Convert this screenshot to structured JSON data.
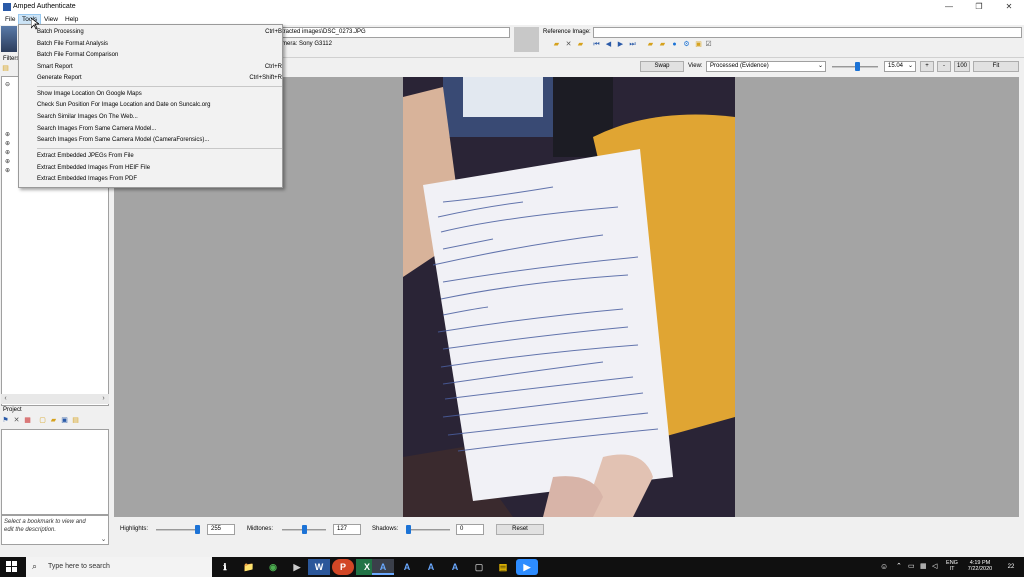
{
  "window": {
    "title": "Amped Authenticate",
    "minimize": "—",
    "restore": "❐",
    "close": "✕"
  },
  "menubar": {
    "items": [
      "File",
      "Tools",
      "View",
      "Help"
    ]
  },
  "tools_menu": {
    "group1": [
      {
        "label": "Batch Processing",
        "shortcut": "Ctrl+B"
      },
      {
        "label": "Batch File Format Analysis",
        "shortcut": ""
      },
      {
        "label": "Batch File Format Comparison",
        "shortcut": ""
      },
      {
        "label": "Smart Report",
        "shortcut": "Ctrl+R"
      },
      {
        "label": "Generate Report",
        "shortcut": "Ctrl+Shift+R"
      }
    ],
    "group2": [
      {
        "label": "Show Image Location On Google Maps"
      },
      {
        "label": "Check Sun Position For Image Location and Date on Suncalc.org"
      },
      {
        "label": "Search Similar Images On The Web..."
      },
      {
        "label": "Search Images From Same Camera Model..."
      },
      {
        "label": "Search Images From Same Camera Model (CameraForensics)..."
      }
    ],
    "group3": [
      {
        "label": "Extract Embedded JPEGs From File"
      },
      {
        "label": "Extract Embedded Images From HEIF File"
      },
      {
        "label": "Extract Embedded Images From PDF"
      }
    ]
  },
  "evidence": {
    "path_fragment": "tracted images\\DSC_0273.JPG",
    "camera_fragment": "mera: Sony G3112"
  },
  "reference": {
    "label": "Reference Image:",
    "value": ""
  },
  "filters_panel": {
    "label": "Filters"
  },
  "project_panel": {
    "label": "Project"
  },
  "description_hint": "Select a bookmark to view and edit the description.",
  "view_toolbar": {
    "swap": "Swap",
    "view_label": "View:",
    "view_value": "Processed (Evidence)",
    "zoom_value": "15.04",
    "zoom_in": "+",
    "zoom_out": "-",
    "zoom_100": "100",
    "fit": "Fit",
    "zoom_slider_fraction": 0.56
  },
  "adjustments": {
    "highlights_label": "Highlights:",
    "highlights_value": "255",
    "highlights_fraction": 1.0,
    "midtones_label": "Midtones:",
    "midtones_value": "127",
    "midtones_fraction": 0.5,
    "shadows_label": "Shadows:",
    "shadows_value": "0",
    "shadows_fraction": 0.0,
    "reset": "Reset"
  },
  "taskbar": {
    "search_placeholder": "Type here to search",
    "apps": [
      "ℹ",
      "📁",
      "◉",
      "▶",
      "W",
      "P",
      "X",
      "A",
      "A",
      "A",
      "A",
      "▢",
      "▤",
      "▶"
    ],
    "lang_top": "ENG",
    "lang_bottom": "IT",
    "time": "4:19 PM",
    "date": "7/22/2020",
    "notification_count": "22"
  }
}
